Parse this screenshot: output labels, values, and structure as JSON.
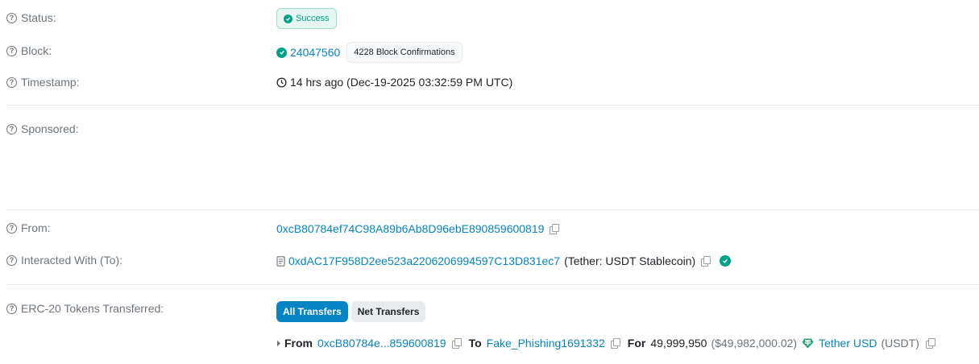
{
  "status": {
    "label": "Status:",
    "value": "Success"
  },
  "block": {
    "label": "Block:",
    "number": "24047560",
    "confirmations": "4228 Block Confirmations"
  },
  "timestamp": {
    "label": "Timestamp:",
    "value": "14 hrs ago (Dec-19-2025 03:32:59 PM UTC)"
  },
  "sponsored": {
    "label": "Sponsored:"
  },
  "from": {
    "label": "From:",
    "address": "0xcB80784ef74C98A89b6Ab8D96ebE890859600819"
  },
  "to": {
    "label": "Interacted With (To):",
    "address": "0xdAC17F958D2ee523a2206206994597C13D831ec7",
    "name": "(Tether: USDT Stablecoin)"
  },
  "tokens": {
    "label": "ERC-20 Tokens Transferred:",
    "tabs": {
      "all": "All Transfers",
      "net": "Net Transfers"
    },
    "transfer": {
      "from_label": "From",
      "from_address": "0xcB80784e...859600819",
      "to_label": "To",
      "to_address": "Fake_Phishing1691332",
      "for_label": "For",
      "amount": "49,999,950",
      "usd_value": "($49,982,000.02)",
      "token_name": "Tether USD",
      "token_symbol": "(USDT)"
    }
  },
  "colors": {
    "accent": "#0784c3",
    "success": "#00a186",
    "tether": "#26a17b"
  },
  "icons": [
    "question-icon",
    "check-circle-icon",
    "clock-icon",
    "copy-icon",
    "contract-icon",
    "verified-icon",
    "caret-right-icon",
    "tether-icon"
  ]
}
